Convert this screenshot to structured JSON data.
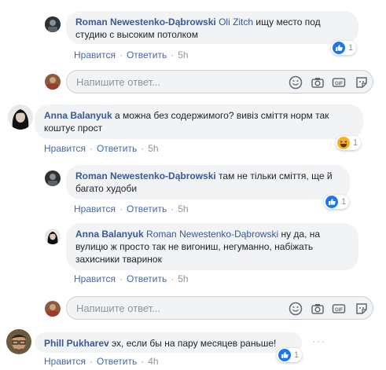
{
  "common": {
    "like_label": "Нравится",
    "reply_label": "Ответить",
    "separator": "·",
    "reply_placeholder": "Напишите ответ..."
  },
  "comments": [
    {
      "author": "Roman Newestenko-Dąbrowski",
      "mention": "Oli Zitch",
      "text": "ищу место под студию с высоким потолком",
      "time": "5h",
      "reaction": {
        "type": "like",
        "count": "1"
      }
    },
    {
      "author": "Anna Balanyuk",
      "mention": "",
      "text": "а можна без содержимого? вивіз сміття норм так коштує прост",
      "time": "5h",
      "reaction": {
        "type": "haha",
        "count": "1"
      }
    },
    {
      "author": "Roman Newestenko-Dąbrowski",
      "mention": "",
      "text": "там не тільки сміття, ще й багато худоби",
      "time": "5h",
      "reaction": {
        "type": "like",
        "count": "1"
      }
    },
    {
      "author": "Anna Balanyuk",
      "mention": "Roman Newestenko-Dąbrowski",
      "text": "ну да, на вулицю ж просто так не вигониш, негуманно, набіжать захисники тваринок",
      "time": "5h",
      "reaction": null
    },
    {
      "author": "Phill Pukharev",
      "mention": "",
      "text": "эх, если бы на пару месяцев раньше!",
      "time": "4h",
      "reaction": {
        "type": "like",
        "count": "1"
      }
    }
  ],
  "colors": {
    "link": "#385898",
    "action": "#4267b2",
    "meta": "#90949c",
    "bubble": "#f2f3f5",
    "like": "#1877f2",
    "haha": "#f7b125"
  }
}
